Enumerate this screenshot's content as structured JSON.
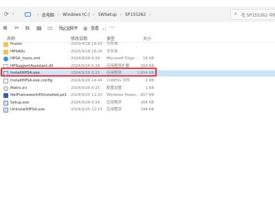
{
  "address": {
    "crumbs": [
      "此电脑",
      "Windows (C:)",
      "SWSetup",
      "SP155262"
    ],
    "search_placeholder": "在 SP155262 中搜索"
  },
  "toolbar": {
    "sort_label": "排序",
    "view_label": "查看"
  },
  "columns": {
    "name": "名称",
    "date": "修改日期",
    "type": "类型",
    "size": "大小"
  },
  "files": [
    {
      "name": "Fusion",
      "date": "2025/4/18 18:20",
      "type": "文件夹",
      "size": "",
      "icon": "folder-icon"
    },
    {
      "name": "HPSAfix",
      "date": "2025/4/18 18:20",
      "type": "文件夹",
      "size": "",
      "icon": "folder-icon"
    },
    {
      "name": "HPSA_trans.xml",
      "date": "2024/9/26 6:26",
      "type": "Microsoft Edge ...",
      "size": "16 KB",
      "icon": "edge-icon"
    },
    {
      "name": "HPSupportAssistant.dll",
      "date": "2024/9/26 6:26",
      "type": "应用程序扩展",
      "size": "159 KB",
      "icon": "document-icon"
    },
    {
      "name": "InstallHPSA.exe",
      "date": "2024/9/26 6:25",
      "type": "应用程序",
      "size": "1,654 KB",
      "icon": "application-icon"
    },
    {
      "name": "InstallHPSA.exe.config",
      "date": "2024/9/26 14:44",
      "type": "CONFIG 文件",
      "size": "2 KB",
      "icon": "config-file-icon"
    },
    {
      "name": "Metro.ini",
      "date": "2024/9/26 6:25",
      "type": "配置设置",
      "size": "1 KB",
      "icon": "settings-file-icon"
    },
    {
      "name": "NetFramework45Installed.ps1",
      "date": "2024/9/25 11:33",
      "type": "Windows Power...",
      "size": "657 KB",
      "icon": "powershell-icon"
    },
    {
      "name": "Setup.exe",
      "date": "2024/9/26 6:34",
      "type": "应用程序",
      "size": "264 KB",
      "icon": "application-icon"
    },
    {
      "name": "UninstallHPSA.exe",
      "date": "2024/9/25 12:13",
      "type": "应用程序",
      "size": "194 KB",
      "icon": "application-icon"
    }
  ],
  "selected_index": 4,
  "colors": {
    "selection": "#cce4f7",
    "highlight": "#e0262e",
    "folder": "#f3c344"
  }
}
